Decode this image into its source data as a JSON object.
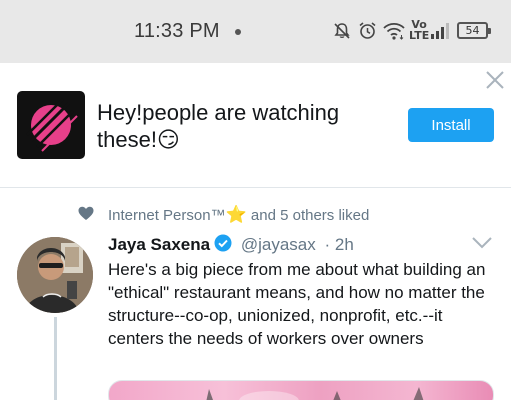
{
  "status_bar": {
    "time": "11:33 PM",
    "network_line1": "Vo",
    "network_line2": "LTE",
    "battery": "54",
    "icons": [
      "mute-icon",
      "alarm-icon",
      "wifi-icon",
      "signal-icon",
      "battery-icon"
    ]
  },
  "banner": {
    "message": "Hey!people are watching these!😏",
    "install_label": "Install",
    "accent_color": "#1da1f2"
  },
  "tweet": {
    "liked_by": "Internet Person™",
    "liked_star": "⭐",
    "liked_suffix": "and 5 others liked",
    "author_name": "Jaya Saxena",
    "handle": "@jayasax",
    "separator": "·",
    "time_ago": "2h",
    "text": "Here's a big piece from me about what building an \"ethical\" restaurant means, and how no matter the structure--co-op, unionized, nonprofit, etc.--it centers the needs of workers over owners"
  }
}
